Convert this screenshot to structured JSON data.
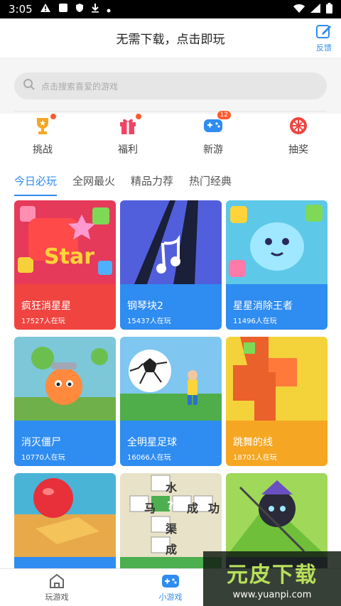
{
  "status": {
    "time": "3:05"
  },
  "header": {
    "title": "无需下载，点击即玩",
    "feedback_label": "反馈"
  },
  "search": {
    "placeholder": "点击搜索喜爱的游戏"
  },
  "quick": [
    {
      "label": "挑战",
      "icon": "trophy-icon",
      "badge": ""
    },
    {
      "label": "福利",
      "icon": "gift-icon",
      "badge": ""
    },
    {
      "label": "新游",
      "icon": "gamepad-icon",
      "badge": "12"
    },
    {
      "label": "抽奖",
      "icon": "lottery-wheel-icon",
      "badge": ""
    }
  ],
  "tabs": [
    "今日必玩",
    "全网最火",
    "精品力荐",
    "热门经典"
  ],
  "games": [
    {
      "name": "疯狂消星星",
      "count": "17527人在玩",
      "color": "#f04440",
      "art_text": "Star"
    },
    {
      "name": "钢琴块2",
      "count": "15437人在玩",
      "color": "#2f8cf0",
      "art_text": ""
    },
    {
      "name": "星星消除王者",
      "count": "11496人在玩",
      "color": "#2f8cf0",
      "art_text": ""
    },
    {
      "name": "消灭僵尸",
      "count": "10770人在玩",
      "color": "#2f8cf0",
      "art_text": ""
    },
    {
      "name": "全明星足球",
      "count": "16066人在玩",
      "color": "#2f8cf0",
      "art_text": ""
    },
    {
      "name": "跳舞的线",
      "count": "18701人在玩",
      "color": "#f5a623",
      "art_text": ""
    },
    {
      "name": "",
      "count": "",
      "color": "#2f8cf0",
      "art_text": ""
    },
    {
      "name": "",
      "count": "",
      "color": "#4caf50",
      "art_text": "马 ? 成 功 水 渠 成"
    },
    {
      "name": "",
      "count": "",
      "color": "#4a3a7a",
      "art_text": ""
    }
  ],
  "idiom_chars": {
    "top": "水",
    "left": "马",
    "center": "?",
    "right1": "成",
    "right2": "功",
    "mid": "渠",
    "bottom": "成"
  },
  "nav": [
    {
      "label": "玩游戏",
      "icon": "home-icon"
    },
    {
      "label": "小游戏",
      "icon": "gamepad-icon"
    },
    {
      "label": "",
      "icon": ""
    }
  ],
  "watermark": {
    "title": "元皮下载",
    "url": "www.yuanpi.com"
  },
  "colors": {
    "accent": "#2f8cf0",
    "red": "#f04440",
    "orange": "#f5a623"
  }
}
